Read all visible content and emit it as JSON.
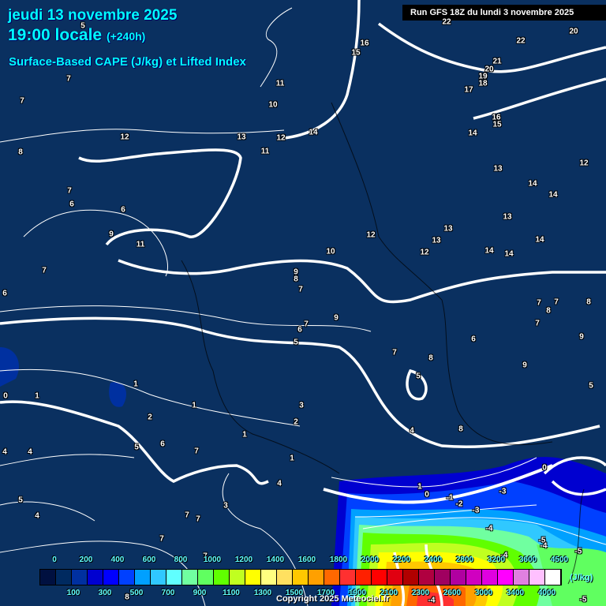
{
  "header": {
    "date": "jeudi 13 novembre 2025",
    "time": "19:00 locale",
    "lead": "(+240h)",
    "parameter": "Surface-Based CAPE (J/kg) et Lifted Index",
    "run": "Run GFS 18Z du lundi 3 novembre 2025"
  },
  "legend": {
    "unit": "(J/kg)",
    "top_labels": [
      "0",
      "200",
      "400",
      "600",
      "800",
      "1000",
      "1200",
      "1400",
      "1600",
      "1800",
      "2000",
      "2200",
      "2400",
      "2800",
      "3200",
      "3600",
      "4500"
    ],
    "bottom_labels": [
      "100",
      "300",
      "500",
      "700",
      "900",
      "1100",
      "1300",
      "1500",
      "1700",
      "1900",
      "2100",
      "2300",
      "2600",
      "3000",
      "3400",
      "4000"
    ],
    "colors": [
      "#001040",
      "#002a60",
      "#0030a0",
      "#0000d0",
      "#0000ff",
      "#0040ff",
      "#00a0ff",
      "#30c8ff",
      "#60ffff",
      "#70ffa0",
      "#60ff60",
      "#60ff00",
      "#c0ff20",
      "#ffff00",
      "#ffff80",
      "#ffe060",
      "#ffc800",
      "#ffa000",
      "#ff6800",
      "#ff3030",
      "#ff2000",
      "#ff0000",
      "#e00010",
      "#b00000",
      "#b00040",
      "#a00060",
      "#b000a0",
      "#d000c0",
      "#e000e0",
      "#ff00ff",
      "#e080e0",
      "#ffc0ff",
      "#ffffff"
    ]
  },
  "copyright": "Copyright 2025 Meteociel.fr",
  "lifted_index_labels": [
    "5",
    "7",
    "7",
    "8",
    "12",
    "7",
    "6",
    "6",
    "9",
    "11",
    "7",
    "6",
    "11",
    "10",
    "13",
    "11",
    "12",
    "14",
    "16",
    "15",
    "22",
    "22",
    "20",
    "21",
    "20",
    "19",
    "18",
    "17",
    "16",
    "15",
    "14",
    "12",
    "13",
    "14",
    "14",
    "13",
    "13",
    "13",
    "12",
    "12",
    "10",
    "14",
    "14",
    "14",
    "9",
    "8",
    "7",
    "7",
    "8",
    "7",
    "8",
    "7",
    "9",
    "7",
    "6",
    "5",
    "6",
    "9",
    "8",
    "7",
    "9",
    "5",
    "5",
    "1",
    "0",
    "1",
    "1",
    "3",
    "2",
    "2",
    "4",
    "8",
    "4",
    "4",
    "5",
    "6",
    "7",
    "1",
    "1",
    "0",
    "4",
    "5",
    "4",
    "3",
    "7",
    "7",
    "7",
    "1",
    "0",
    "-1",
    "-2",
    "-3",
    "-3",
    "-4",
    "-5",
    "-4",
    "-5",
    "-4",
    "-5",
    "-4",
    "8",
    "7"
  ]
}
